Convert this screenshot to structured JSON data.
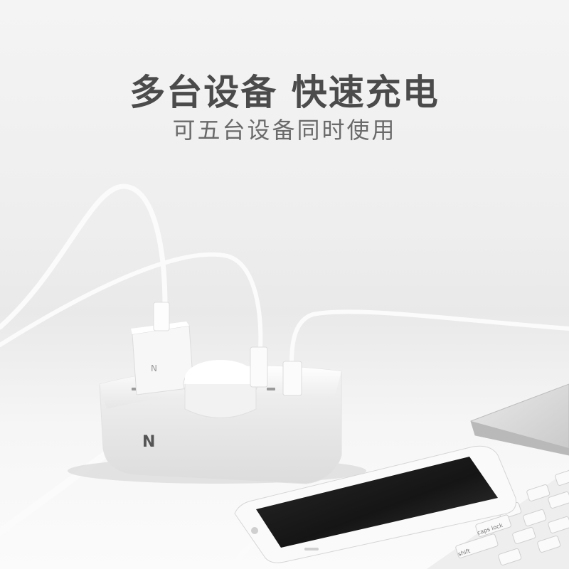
{
  "headline": "多台设备 快速充电",
  "subheadline": "可五台设备同时使用",
  "brand_mark": "N",
  "keyboard_keys": [
    "caps lock",
    "shift"
  ],
  "colors": {
    "background": "#efefef",
    "headline": "#4b4b4b",
    "subheadline": "#6a6a6a",
    "device_white": "#fafafa",
    "phone_screen": "#1e1e1e",
    "laptop_silver": "#d9d9d9"
  }
}
